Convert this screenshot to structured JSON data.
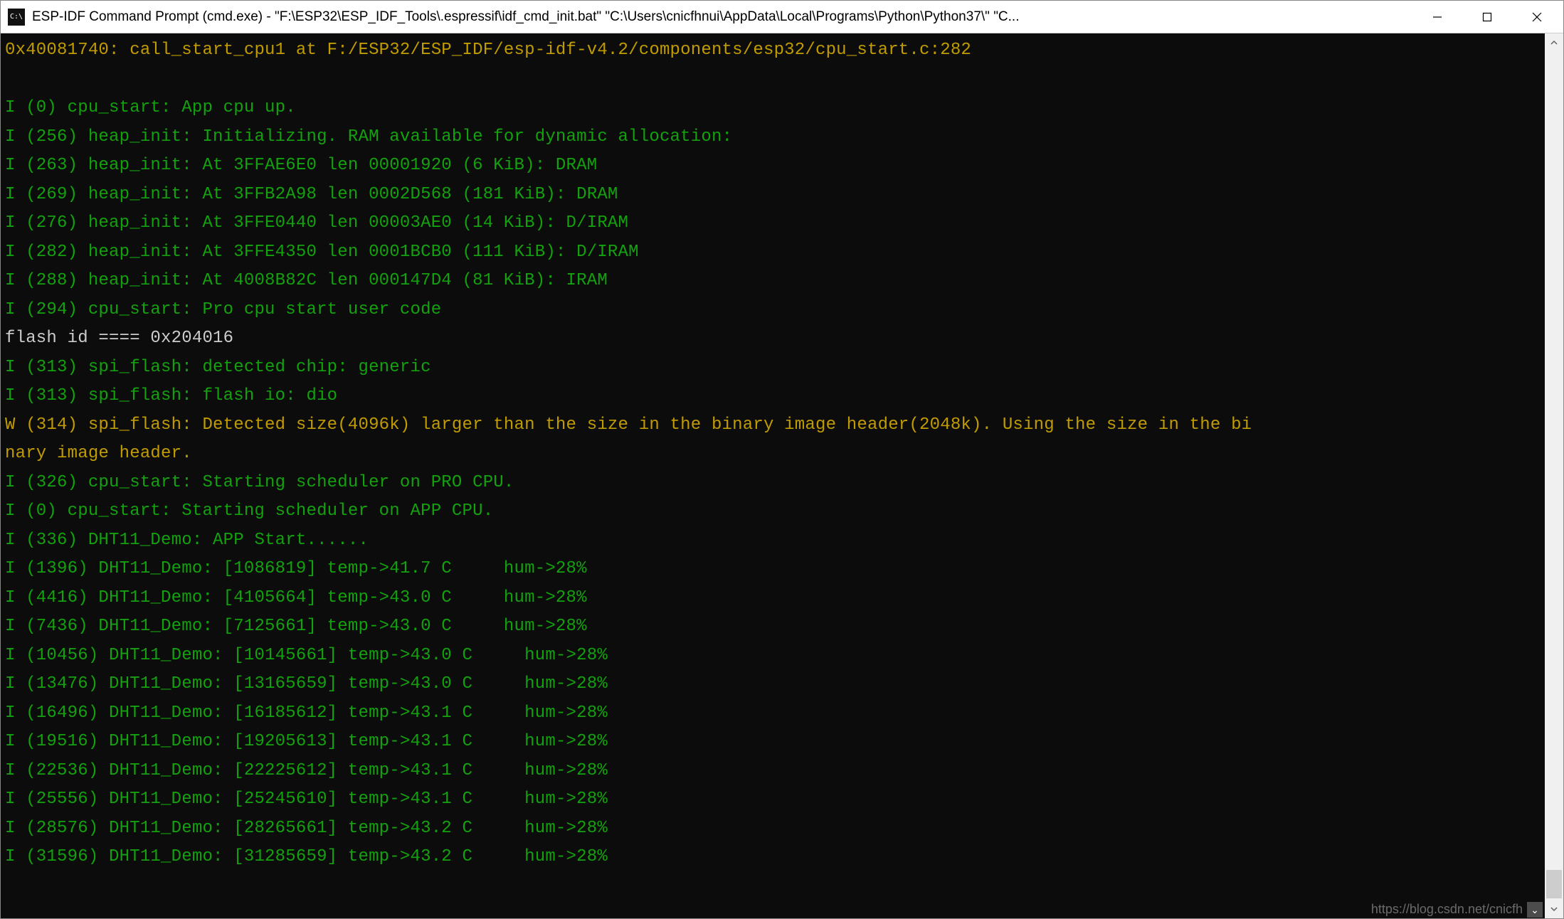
{
  "window": {
    "title": "ESP-IDF Command Prompt (cmd.exe) - \"F:\\ESP32\\ESP_IDF_Tools\\.espressif\\idf_cmd_init.bat\"  \"C:\\Users\\cnicfhnui\\AppData\\Local\\Programs\\Python\\Python37\\\" \"C...",
    "icon_text": "C:\\"
  },
  "terminal": {
    "lines": [
      {
        "cls": "c-yellow",
        "text": "0x40081740: call_start_cpu1 at F:/ESP32/ESP_IDF/esp-idf-v4.2/components/esp32/cpu_start.c:282"
      },
      {
        "cls": "",
        "text": " "
      },
      {
        "cls": "c-green",
        "text": "I (0) cpu_start: App cpu up."
      },
      {
        "cls": "c-green",
        "text": "I (256) heap_init: Initializing. RAM available for dynamic allocation:"
      },
      {
        "cls": "c-green",
        "text": "I (263) heap_init: At 3FFAE6E0 len 00001920 (6 KiB): DRAM"
      },
      {
        "cls": "c-green",
        "text": "I (269) heap_init: At 3FFB2A98 len 0002D568 (181 KiB): DRAM"
      },
      {
        "cls": "c-green",
        "text": "I (276) heap_init: At 3FFE0440 len 00003AE0 (14 KiB): D/IRAM"
      },
      {
        "cls": "c-green",
        "text": "I (282) heap_init: At 3FFE4350 len 0001BCB0 (111 KiB): D/IRAM"
      },
      {
        "cls": "c-green",
        "text": "I (288) heap_init: At 4008B82C len 000147D4 (81 KiB): IRAM"
      },
      {
        "cls": "c-green",
        "text": "I (294) cpu_start: Pro cpu start user code"
      },
      {
        "cls": "c-white",
        "text": "flash id ==== 0x204016"
      },
      {
        "cls": "c-green",
        "text": "I (313) spi_flash: detected chip: generic"
      },
      {
        "cls": "c-green",
        "text": "I (313) spi_flash: flash io: dio"
      },
      {
        "cls": "c-yellow",
        "text": "W (314) spi_flash: Detected size(4096k) larger than the size in the binary image header(2048k). Using the size in the bi"
      },
      {
        "cls": "c-yellow",
        "text": "nary image header."
      },
      {
        "cls": "c-green",
        "text": "I (326) cpu_start: Starting scheduler on PRO CPU."
      },
      {
        "cls": "c-green",
        "text": "I (0) cpu_start: Starting scheduler on APP CPU."
      },
      {
        "cls": "c-green",
        "text": "I (336) DHT11_Demo: APP Start......"
      },
      {
        "cls": "c-green",
        "text": "I (1396) DHT11_Demo: [1086819] temp->41.7 C     hum->28%"
      },
      {
        "cls": "c-green",
        "text": "I (4416) DHT11_Demo: [4105664] temp->43.0 C     hum->28%"
      },
      {
        "cls": "c-green",
        "text": "I (7436) DHT11_Demo: [7125661] temp->43.0 C     hum->28%"
      },
      {
        "cls": "c-green",
        "text": "I (10456) DHT11_Demo: [10145661] temp->43.0 C     hum->28%"
      },
      {
        "cls": "c-green",
        "text": "I (13476) DHT11_Demo: [13165659] temp->43.0 C     hum->28%"
      },
      {
        "cls": "c-green",
        "text": "I (16496) DHT11_Demo: [16185612] temp->43.1 C     hum->28%"
      },
      {
        "cls": "c-green",
        "text": "I (19516) DHT11_Demo: [19205613] temp->43.1 C     hum->28%"
      },
      {
        "cls": "c-green",
        "text": "I (22536) DHT11_Demo: [22225612] temp->43.1 C     hum->28%"
      },
      {
        "cls": "c-green",
        "text": "I (25556) DHT11_Demo: [25245610] temp->43.1 C     hum->28%"
      },
      {
        "cls": "c-green",
        "text": "I (28576) DHT11_Demo: [28265661] temp->43.2 C     hum->28%"
      },
      {
        "cls": "c-green",
        "text": "I (31596) DHT11_Demo: [31285659] temp->43.2 C     hum->28%"
      }
    ]
  },
  "watermark": "https://blog.csdn.net/cnicfh"
}
